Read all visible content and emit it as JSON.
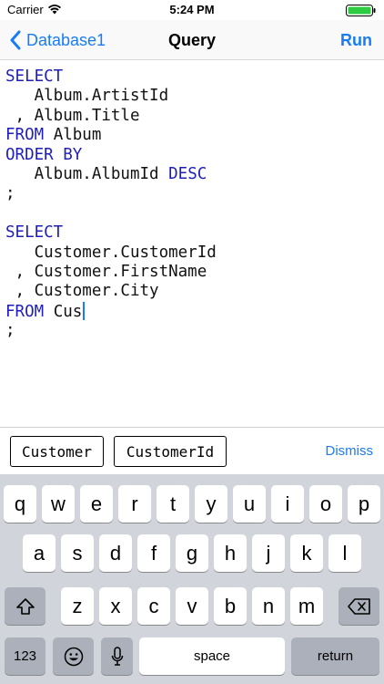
{
  "status_bar": {
    "carrier": "Carrier",
    "time": "5:24 PM"
  },
  "nav": {
    "back_label": "Database1",
    "title": "Query",
    "run_label": "Run"
  },
  "editor": {
    "lines": [
      {
        "keyword": "SELECT",
        "text": ""
      },
      {
        "keyword": "",
        "text": "   Album.ArtistId"
      },
      {
        "keyword": "",
        "text": " , Album.Title"
      },
      {
        "keyword": "FROM",
        "text": " Album"
      },
      {
        "keyword": "ORDER BY",
        "text": ""
      },
      {
        "keyword": "",
        "text": "   Album.AlbumId ",
        "keyword_after": "DESC"
      },
      {
        "keyword": "",
        "text": ";"
      },
      {
        "keyword": "",
        "text": ""
      },
      {
        "keyword": "SELECT",
        "text": ""
      },
      {
        "keyword": "",
        "text": "   Customer.CustomerId"
      },
      {
        "keyword": "",
        "text": " , Customer.FirstName"
      },
      {
        "keyword": "",
        "text": " , Customer.City"
      },
      {
        "keyword": "FROM",
        "text": " Cus",
        "cursor": true
      },
      {
        "keyword": "",
        "text": ";"
      }
    ]
  },
  "suggestions": {
    "items": [
      "Customer",
      "CustomerId"
    ],
    "dismiss_label": "Dismiss"
  },
  "keyboard": {
    "row1": [
      "q",
      "w",
      "e",
      "r",
      "t",
      "y",
      "u",
      "i",
      "o",
      "p"
    ],
    "row2": [
      "a",
      "s",
      "d",
      "f",
      "g",
      "h",
      "j",
      "k",
      "l"
    ],
    "row3": [
      "z",
      "x",
      "c",
      "v",
      "b",
      "n",
      "m"
    ],
    "numbers_label": "123",
    "space_label": "space",
    "return_label": "return"
  },
  "colors": {
    "accent": "#1a7cf3",
    "keyword": "#1f1fb8",
    "keyboard_bg": "#d1d4da"
  }
}
